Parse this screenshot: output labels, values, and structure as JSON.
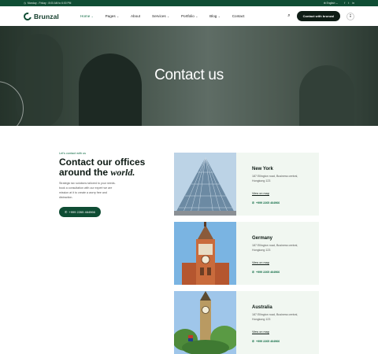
{
  "topbar": {
    "hours": "Monday - Friday : 8:00 AM to 6:00 PM",
    "language": "English",
    "social_icons": [
      "facebook-icon",
      "twitter-icon",
      "linkedin-icon"
    ]
  },
  "header": {
    "brand": "Brunzal",
    "nav": [
      {
        "label": "Home",
        "dropdown": true,
        "active": true
      },
      {
        "label": "Pages",
        "dropdown": true
      },
      {
        "label": "About",
        "dropdown": false
      },
      {
        "label": "Services",
        "dropdown": true
      },
      {
        "label": "Portfolio",
        "dropdown": true
      },
      {
        "label": "Blog",
        "dropdown": true
      },
      {
        "label": "Contact",
        "dropdown": false
      }
    ],
    "cta": "Contact with brunzal"
  },
  "hero": {
    "title": "Contact us"
  },
  "intro": {
    "eyebrow": "Let's contact with us",
    "heading_line1": "Contact our offices",
    "heading_line2": "around the ",
    "heading_emphasis": "world.",
    "body": "Strategic tax solutions tailored to your needs. book a consultation with our expert we are mission at it to create a worry free and distraction.",
    "phone": "+999 2265 464966"
  },
  "offices": [
    {
      "city": "New York",
      "address": "187 Ellington road, Business central, Hongkong 123",
      "map_link": "View on map",
      "phone": "+999 2265 464966"
    },
    {
      "city": "Germany",
      "address": "187 Ellington road, Business central, Hongkong 123",
      "map_link": "View on map",
      "phone": "+999 2265 464966"
    },
    {
      "city": "Australia",
      "address": "187 Ellington road, Business central, Hongkong 123",
      "map_link": "View on map",
      "phone": "+999 2265 464966"
    }
  ],
  "colors": {
    "brand_green": "#0f4d34",
    "accent_green": "#0f6b44",
    "card_bg": "#f1f7f1",
    "dark": "#0f1d16"
  }
}
